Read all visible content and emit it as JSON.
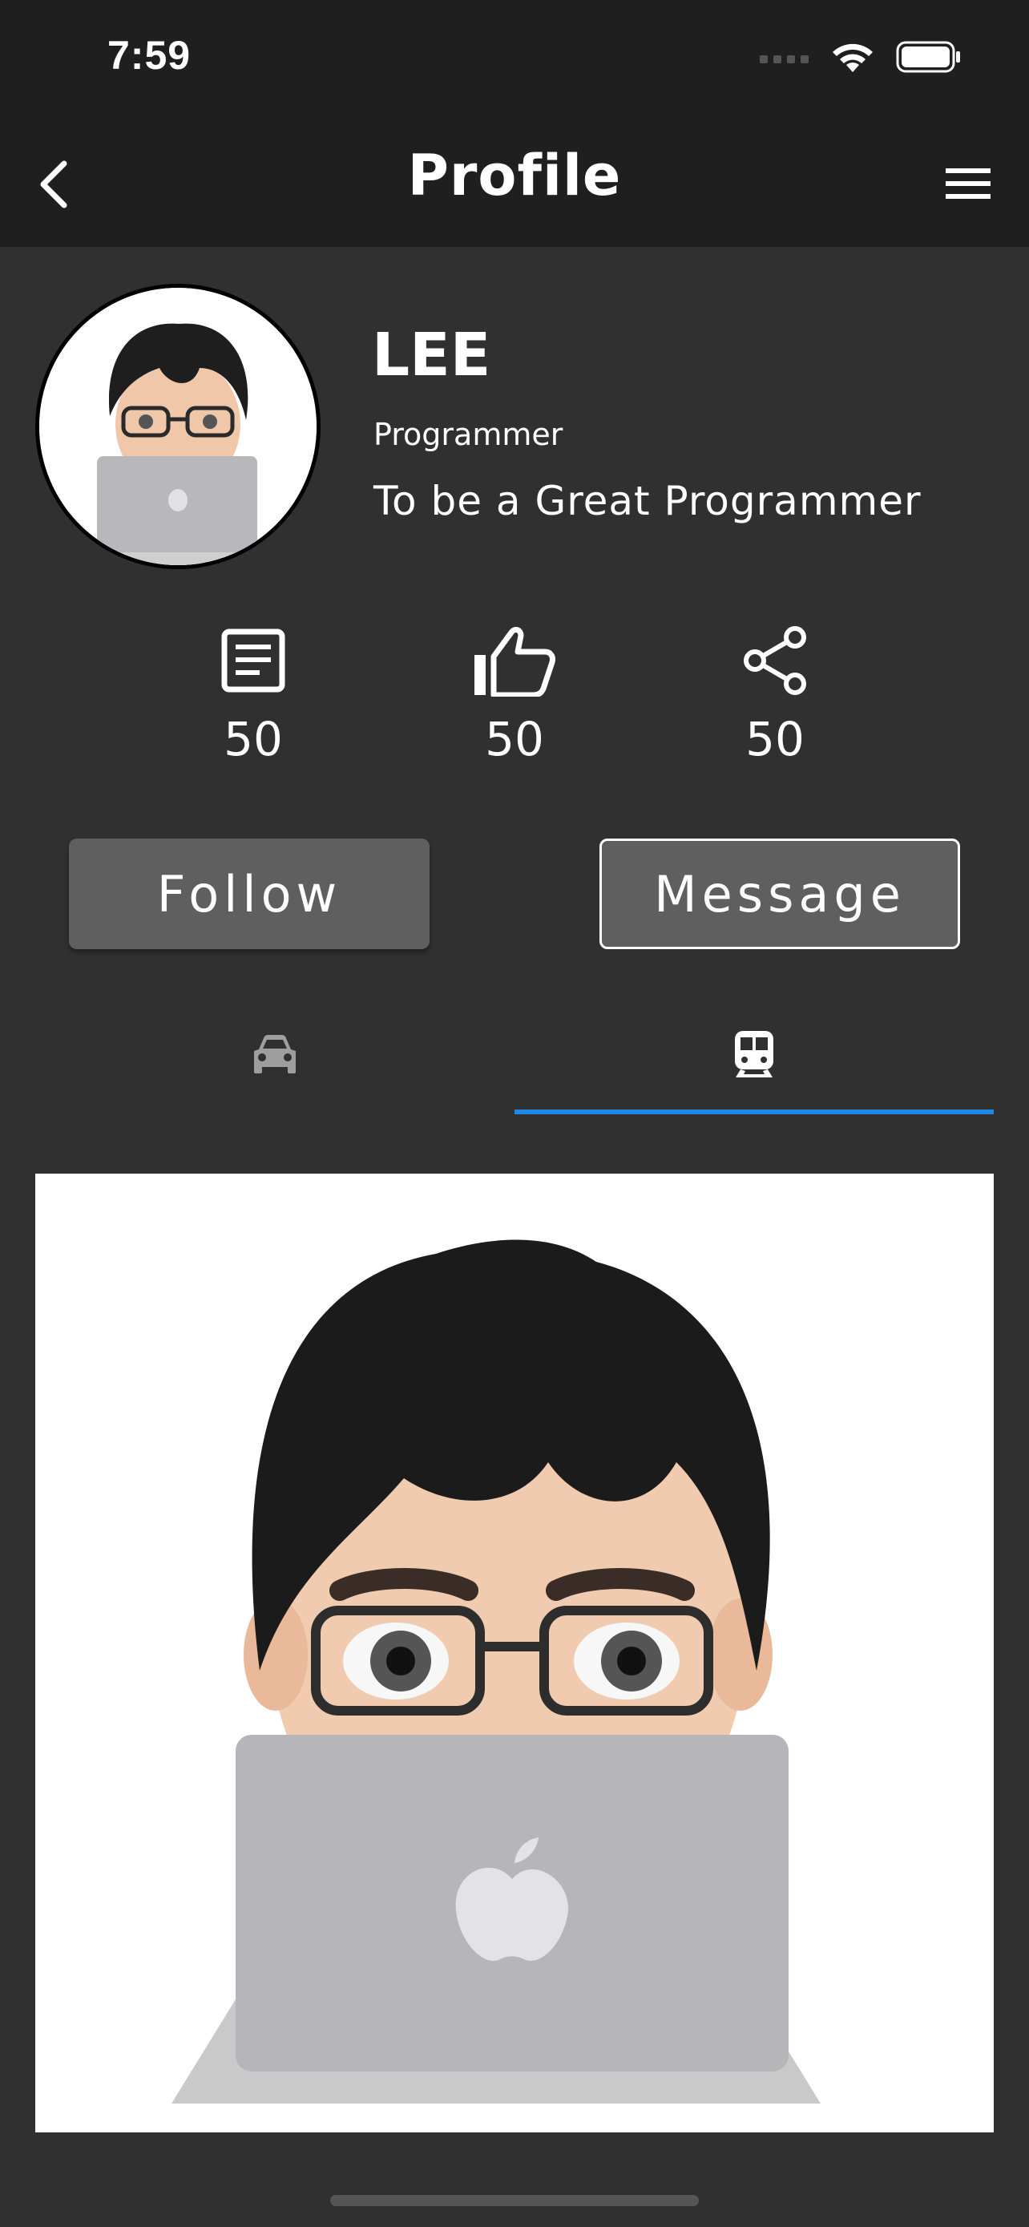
{
  "status_bar": {
    "time": "7:59",
    "icons": [
      "signal-icon",
      "wifi-icon",
      "battery-icon"
    ]
  },
  "app_bar": {
    "title": "Profile",
    "back_icon": "chevron-left-icon",
    "menu_icon": "hamburger-menu-icon"
  },
  "profile": {
    "name": "LEE",
    "role": "Programmer",
    "motto": "To be a Great Programmer",
    "avatar": "memoji-programmer-with-laptop"
  },
  "stats": [
    {
      "icon": "article-icon",
      "value": "50"
    },
    {
      "icon": "thumbs-up-icon",
      "value": "50"
    },
    {
      "icon": "share-icon",
      "value": "50"
    }
  ],
  "buttons": {
    "follow": "Follow",
    "message": "Message"
  },
  "tabs": [
    {
      "icon": "car-icon",
      "selected": false
    },
    {
      "icon": "train-icon",
      "selected": true
    }
  ],
  "colors": {
    "background": "#303030",
    "bar": "#1f1f1f",
    "accent": "#1e88e5",
    "button": "#5f5f5f"
  }
}
